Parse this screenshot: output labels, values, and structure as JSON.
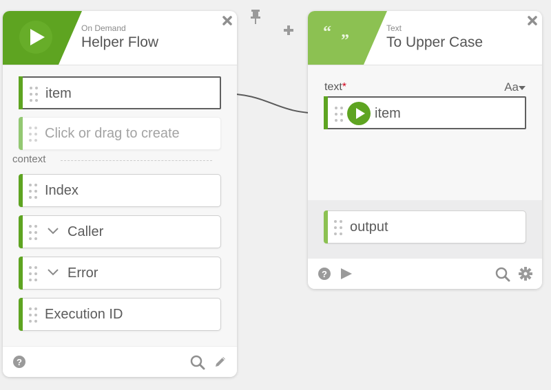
{
  "canvas": {
    "toolbar": {
      "pin_icon": "pin-icon",
      "add_icon": "plus-icon"
    }
  },
  "colors": {
    "trigger_green": "#5ea421",
    "text_green": "#8cc152",
    "required_red": "#d0021b"
  },
  "helper_flow_card": {
    "subtitle": "On Demand",
    "title": "Helper Flow",
    "icon": "play-icon",
    "close_icon": "close-icon",
    "outputs": [
      {
        "label": "item"
      }
    ],
    "placeholder": "Click or drag to create",
    "context_label": "context",
    "context_items": [
      {
        "label": "Index",
        "expandable": false
      },
      {
        "label": "Caller",
        "expandable": true
      },
      {
        "label": "Error",
        "expandable": true
      },
      {
        "label": "Execution ID",
        "expandable": false
      }
    ],
    "footer": {
      "help_icon": "help-icon",
      "search_icon": "search-icon",
      "edit_icon": "pencil-icon"
    }
  },
  "to_upper_case_card": {
    "subtitle": "Text",
    "title": "To Upper Case",
    "icon": "quote-icon",
    "icon_text": "“ ”",
    "close_icon": "close-icon",
    "input_label": "text",
    "required_mark": "*",
    "format_button": "Aa",
    "input_value": "item",
    "output_label": "output",
    "footer": {
      "help_icon": "help-icon",
      "run_icon": "play-icon",
      "search_icon": "search-icon",
      "settings_icon": "gear-icon"
    }
  }
}
